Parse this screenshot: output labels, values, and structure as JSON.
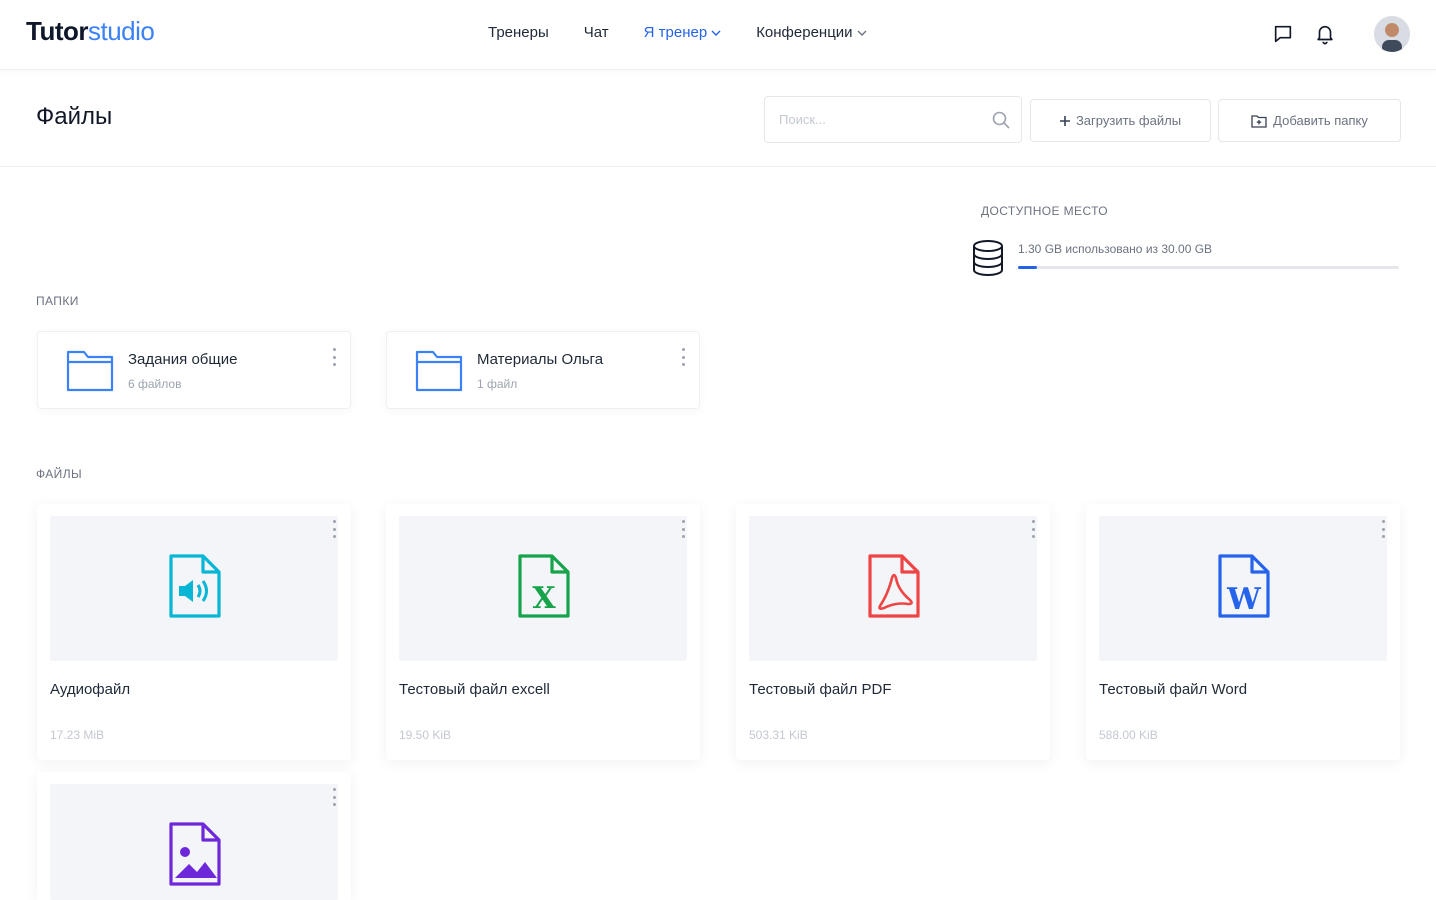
{
  "app": {
    "logo_part1": "Tutor",
    "logo_part2": "studio"
  },
  "nav": {
    "items": [
      {
        "label": "Тренеры",
        "active": false,
        "dropdown": false
      },
      {
        "label": "Чат",
        "active": false,
        "dropdown": false
      },
      {
        "label": "Я тренер",
        "active": true,
        "dropdown": true
      },
      {
        "label": "Конференции",
        "active": false,
        "dropdown": true
      }
    ],
    "icons": [
      "chat-icon",
      "bell-icon"
    ],
    "accent_color": "#2563eb"
  },
  "page": {
    "title": "Файлы",
    "search_placeholder": "Поиск...",
    "upload_button": "Загрузить файлы",
    "add_folder_button": "Добавить папку"
  },
  "storage": {
    "label": "ДОСТУПНОЕ МЕСТО",
    "usage_text": "1.30 GB использовано из 30.00 GB",
    "used_fraction": 0.05
  },
  "folders": {
    "label": "ПАПКИ",
    "items": [
      {
        "name": "Задания общие",
        "count": "6 файлов"
      },
      {
        "name": "Материалы Ольга",
        "count": "1 файл"
      }
    ]
  },
  "files": {
    "label": "ФАЙЛЫ",
    "items": [
      {
        "name": "Аудиофайл",
        "size": "17.23 MiB",
        "icon": "audio-file-icon",
        "color": "#06b6d4"
      },
      {
        "name": "Тестовый файл excell",
        "size": "19.50 KiB",
        "icon": "excel-file-icon",
        "color": "#16a34a"
      },
      {
        "name": "Тестовый файл PDF",
        "size": "503.31 KiB",
        "icon": "pdf-file-icon",
        "color": "#ef4444"
      },
      {
        "name": "Тестовый файл Word",
        "size": "588.00 KiB",
        "icon": "word-file-icon",
        "color": "#2563eb"
      },
      {
        "name": "",
        "size": "",
        "icon": "image-file-icon",
        "color": "#6d28d9"
      }
    ]
  }
}
